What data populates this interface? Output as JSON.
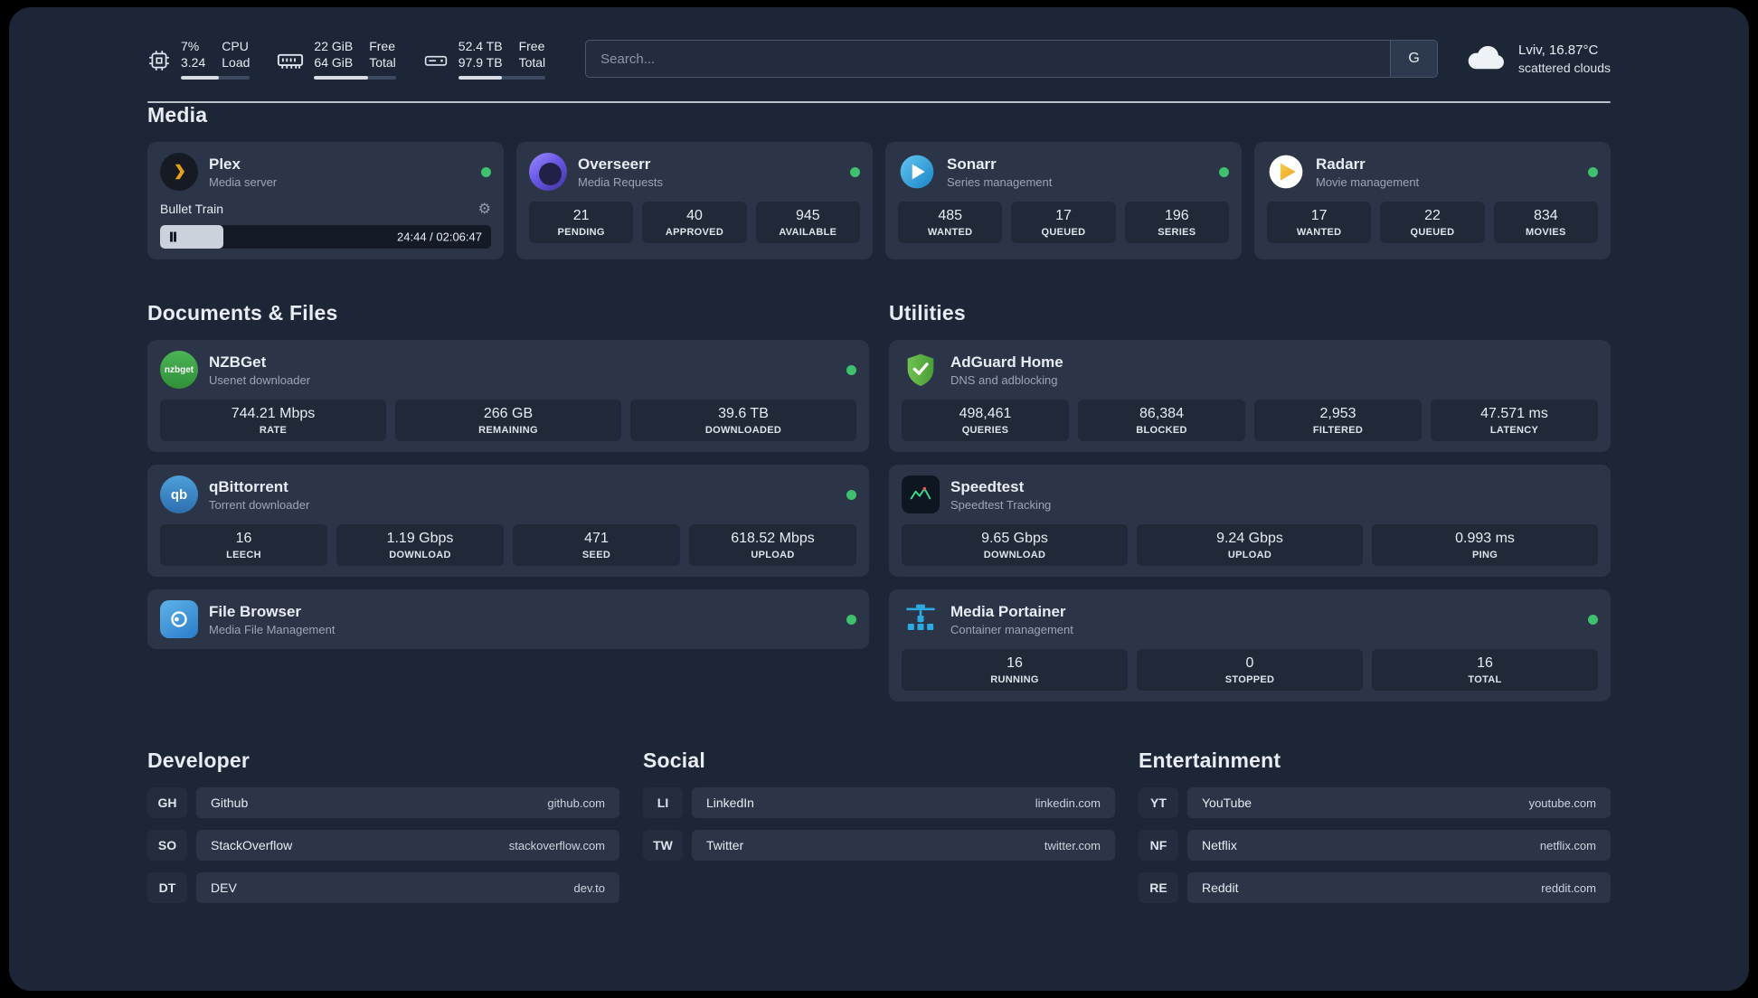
{
  "colors": {
    "panel-bg": "#1d2636",
    "card-bg": "#2b3547",
    "stat-bg": "#1f2938",
    "status-online": "#3fc06c"
  },
  "topbar": {
    "cpu": {
      "value_top": "7%",
      "value_bottom": "3.24",
      "label_top": "CPU",
      "label_bottom": "Load",
      "progress": 55
    },
    "memory": {
      "value_top": "22 GiB",
      "value_bottom": "64 GiB",
      "label_top": "Free",
      "label_bottom": "Total",
      "progress": 66
    },
    "storage": {
      "value_top": "52.4 TB",
      "value_bottom": "97.9 TB",
      "label_top": "Free",
      "label_bottom": "Total",
      "progress": 50
    },
    "search": {
      "placeholder": "Search...",
      "engine_button": "G"
    },
    "weather": {
      "location": "Lviv, 16.87°C",
      "condition": "scattered clouds"
    }
  },
  "section_titles": {
    "media": "Media",
    "documents": "Documents & Files",
    "utilities": "Utilities",
    "developer": "Developer",
    "social": "Social",
    "entertainment": "Entertainment"
  },
  "apps": {
    "plex": {
      "name": "Plex",
      "subtitle": "Media server",
      "player": {
        "now_playing": "Bullet Train",
        "time": "24:44 / 02:06:47",
        "progress": 19
      }
    },
    "overseerr": {
      "name": "Overseerr",
      "subtitle": "Media Requests",
      "stats": [
        {
          "value": "21",
          "label": "PENDING"
        },
        {
          "value": "40",
          "label": "APPROVED"
        },
        {
          "value": "945",
          "label": "AVAILABLE"
        }
      ]
    },
    "sonarr": {
      "name": "Sonarr",
      "subtitle": "Series management",
      "stats": [
        {
          "value": "485",
          "label": "WANTED"
        },
        {
          "value": "17",
          "label": "QUEUED"
        },
        {
          "value": "196",
          "label": "SERIES"
        }
      ]
    },
    "radarr": {
      "name": "Radarr",
      "subtitle": "Movie management",
      "stats": [
        {
          "value": "17",
          "label": "WANTED"
        },
        {
          "value": "22",
          "label": "QUEUED"
        },
        {
          "value": "834",
          "label": "MOVIES"
        }
      ]
    },
    "nzbget": {
      "name": "NZBGet",
      "subtitle": "Usenet downloader",
      "icon_text": "nzbget",
      "stats": [
        {
          "value": "744.21 Mbps",
          "label": "RATE"
        },
        {
          "value": "266 GB",
          "label": "REMAINING"
        },
        {
          "value": "39.6 TB",
          "label": "DOWNLOADED"
        }
      ]
    },
    "qbittorrent": {
      "name": "qBittorrent",
      "subtitle": "Torrent downloader",
      "icon_text": "qb",
      "stats": [
        {
          "value": "16",
          "label": "LEECH"
        },
        {
          "value": "1.19 Gbps",
          "label": "DOWNLOAD"
        },
        {
          "value": "471",
          "label": "SEED"
        },
        {
          "value": "618.52 Mbps",
          "label": "UPLOAD"
        }
      ]
    },
    "filebrowser": {
      "name": "File Browser",
      "subtitle": "Media File Management"
    },
    "adguard": {
      "name": "AdGuard Home",
      "subtitle": "DNS and adblocking",
      "stats": [
        {
          "value": "498,461",
          "label": "QUERIES"
        },
        {
          "value": "86,384",
          "label": "BLOCKED"
        },
        {
          "value": "2,953",
          "label": "FILTERED"
        },
        {
          "value": "47.571 ms",
          "label": "LATENCY"
        }
      ]
    },
    "speedtest": {
      "name": "Speedtest",
      "subtitle": "Speedtest Tracking",
      "stats": [
        {
          "value": "9.65 Gbps",
          "label": "DOWNLOAD"
        },
        {
          "value": "9.24 Gbps",
          "label": "UPLOAD"
        },
        {
          "value": "0.993 ms",
          "label": "PING"
        }
      ]
    },
    "portainer": {
      "name": "Media Portainer",
      "subtitle": "Container management",
      "stats": [
        {
          "value": "16",
          "label": "RUNNING"
        },
        {
          "value": "0",
          "label": "STOPPED"
        },
        {
          "value": "16",
          "label": "TOTAL"
        }
      ]
    }
  },
  "bookmarks": {
    "developer": [
      {
        "abbr": "GH",
        "name": "Github",
        "url": "github.com"
      },
      {
        "abbr": "SO",
        "name": "StackOverflow",
        "url": "stackoverflow.com"
      },
      {
        "abbr": "DT",
        "name": "DEV",
        "url": "dev.to"
      }
    ],
    "social": [
      {
        "abbr": "LI",
        "name": "LinkedIn",
        "url": "linkedin.com"
      },
      {
        "abbr": "TW",
        "name": "Twitter",
        "url": "twitter.com"
      }
    ],
    "entertainment": [
      {
        "abbr": "YT",
        "name": "YouTube",
        "url": "youtube.com"
      },
      {
        "abbr": "NF",
        "name": "Netflix",
        "url": "netflix.com"
      },
      {
        "abbr": "RE",
        "name": "Reddit",
        "url": "reddit.com"
      }
    ]
  }
}
